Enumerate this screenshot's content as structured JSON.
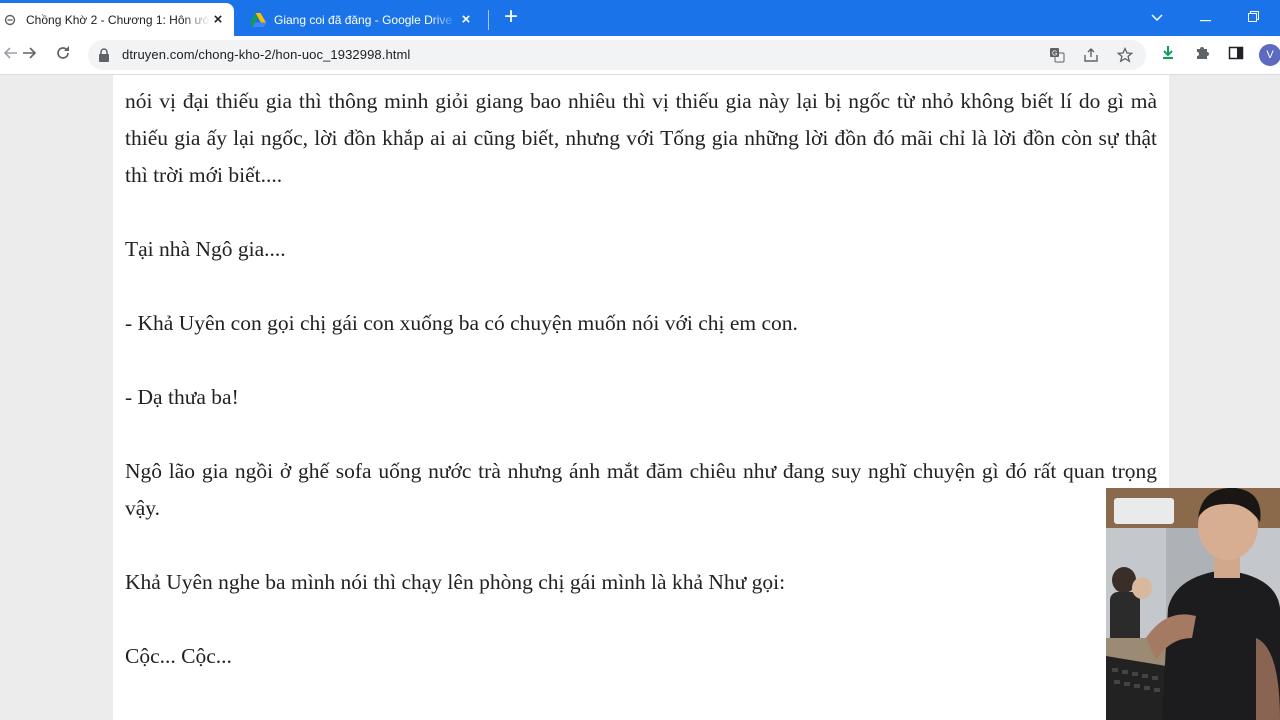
{
  "browser": {
    "tabs": [
      {
        "title": "Chồng Khờ 2 - Chương 1: Hôn ước",
        "active": true
      },
      {
        "title": "Giang coi đã đăng - Google Drive",
        "active": false
      }
    ],
    "url": "dtruyen.com/chong-kho-2/hon-uoc_1932998.html",
    "profile_initial": "V",
    "accent_color": "#1a73e8"
  },
  "article": {
    "paragraphs": [
      "nói vị đại thiếu gia thì thông minh giỏi giang bao nhiêu thì vị thiếu gia này lại bị ngốc từ nhỏ không biết lí do gì mà thiếu gia ấy lại ngốc, lời đồn khắp ai ai cũng biết, nhưng với Tống gia những lời đồn đó mãi chỉ là lời đồn còn sự thật thì trời mới biết....",
      "Tại nhà Ngô gia....",
      "- Khả Uyên con gọi chị gái con xuống ba có chuyện muốn nói với chị em con.",
      "- Dạ thưa ba!",
      "Ngô lão gia ngồi ở ghế sofa uống nước trà nhưng ánh mắt đăm chiêu như đang suy nghĩ chuyện gì đó rất quan trọng vậy.",
      "Khả Uyên nghe ba mình nói thì chạy lên phòng chị gái mình là khả Như gọi:",
      "Cộc... Cộc..."
    ]
  }
}
